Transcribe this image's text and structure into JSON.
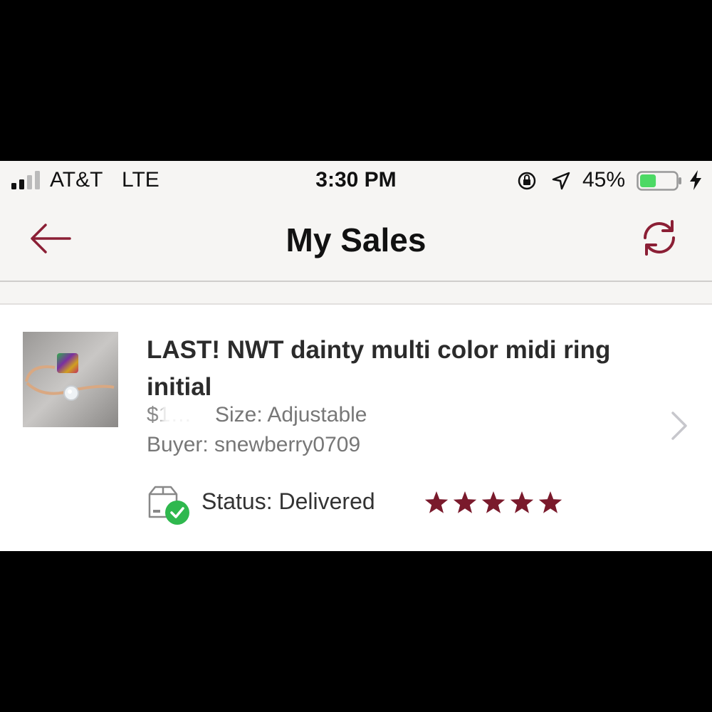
{
  "status_bar": {
    "carrier": "AT&T",
    "network": "LTE",
    "time": "3:30 PM",
    "battery_percent": "45%",
    "battery_level": 0.45,
    "signal_bars": 2
  },
  "nav": {
    "title": "My Sales",
    "back_icon": "arrow-left-icon",
    "refresh_icon": "refresh-icon"
  },
  "sale": {
    "title": "LAST! NWT dainty multi color midi ring initial",
    "price": "$1…",
    "size": "Size: Adjustable",
    "buyer": "Buyer: snewberry0709",
    "status": "Status:  Delivered",
    "rating": 5,
    "rating_max": 5
  },
  "colors": {
    "accent": "#8b1f35",
    "star": "#7a1a2c",
    "battery_fill": "#4cd964",
    "check_green": "#2fb84e"
  }
}
